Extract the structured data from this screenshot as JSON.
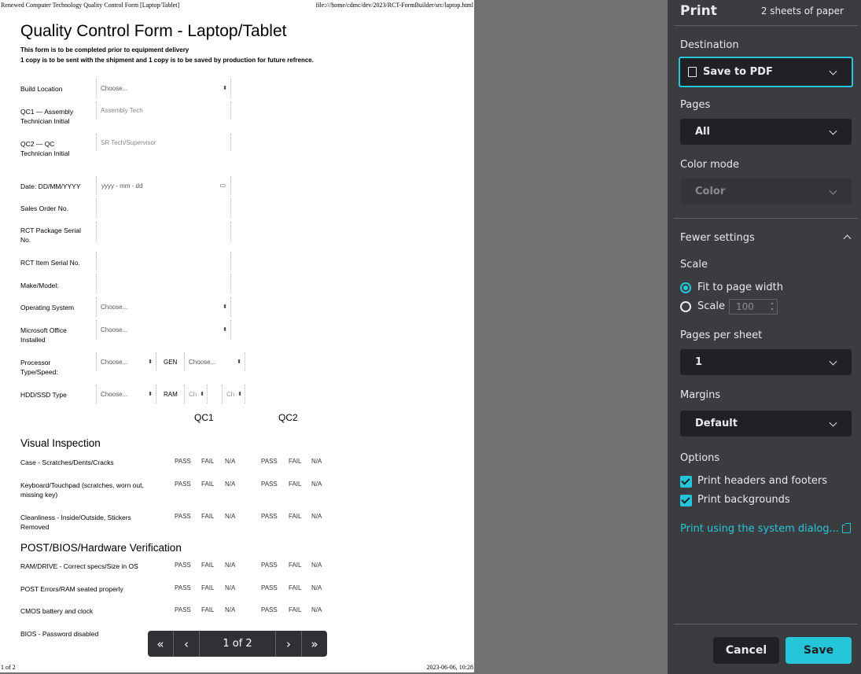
{
  "preview": {
    "header_left": "Renewed Computer Technology Quality Control Form [Laptop/Tablet]",
    "header_right": "file:///home/cdmc/dev/2023/RCT-FormBuilder/src/laptop.html",
    "footer_left": "1 of 2",
    "footer_right": "2023-06-06, 10:28",
    "form_title": "Quality Control Form - Laptop/Tablet",
    "note1": "This form is to be completed prior to equipment delivery",
    "note2": "1 copy is to be sent with the shipment and 1 copy is to be saved by production for future refrence.",
    "fields": {
      "build_location": "Build Location",
      "qc1": "QC1 — Assembly Technician Initial",
      "qc2": "QC2 — QC Technician Initial",
      "date": "Date: DD/MM/YYYY",
      "sales_order": "Sales Order No.",
      "package_serial": "RCT Package Serial No.",
      "item_serial": "RCT Item Serial No.",
      "make_model": "Make/Model:",
      "os": "Operating System",
      "office": "Microsoft Office Installed",
      "processor": "Processor Type/Speed:",
      "hdd": "HDD/SSD Type",
      "gen": "GEN",
      "ram": "RAM"
    },
    "placeholders": {
      "choose": "Choose...",
      "assembly_tech": "Assembly Tech",
      "sr_tech": "SR Tech/Supervisor",
      "date_fmt": "yyyy - mm - dd",
      "ch": "Ch"
    },
    "qc1_head": "QC1",
    "qc2_head": "QC2",
    "opts": {
      "pass": "PASS",
      "fail": "FAIL",
      "na": "N/A"
    },
    "visual_title": "Visual Inspection",
    "visual_items": [
      "Case - Scratches/Dents/Cracks",
      "Keyboard/Touchpad (scratches, worn out, missing key)",
      "Cleanliness - Inside/Outside, Stickers Removed"
    ],
    "post_title": "POST/BIOS/Hardware Verification",
    "post_items": [
      "RAM/DRIVE - Correct specs/Size in OS",
      "POST Errors/RAM seated properly",
      "CMOS battery and clock",
      "BIOS - Password disabled"
    ],
    "page_indicator": "1 of 2"
  },
  "panel": {
    "title": "Print",
    "sheets": "2 sheets of paper",
    "destination_label": "Destination",
    "destination_value": "Save to PDF",
    "pages_label": "Pages",
    "pages_value": "All",
    "color_label": "Color mode",
    "color_value": "Color",
    "fewer_settings": "Fewer settings",
    "scale_label": "Scale",
    "fit_width": "Fit to page width",
    "scale_option": "Scale",
    "scale_value": "100",
    "pps_label": "Pages per sheet",
    "pps_value": "1",
    "margins_label": "Margins",
    "margins_value": "Default",
    "options_label": "Options",
    "headers_footers": "Print headers and footers",
    "backgrounds": "Print backgrounds",
    "system_dialog": "Print using the system dialog...",
    "cancel": "Cancel",
    "save": "Save",
    "accent": "#26c6da"
  }
}
